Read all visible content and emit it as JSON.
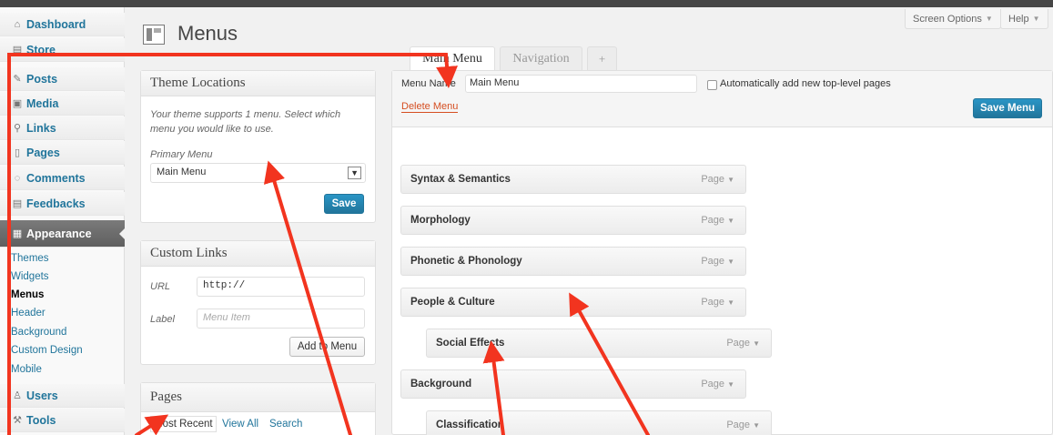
{
  "header": {
    "title": "Menus",
    "screen_options": "Screen Options",
    "help": "Help"
  },
  "sidebar": {
    "items": [
      {
        "label": "Dashboard",
        "icon": "dashboard-icon",
        "glyph": "⌂"
      },
      {
        "label": "Store",
        "icon": "store-icon",
        "glyph": "▤"
      },
      {
        "label": "Posts",
        "icon": "posts-icon",
        "glyph": "✎"
      },
      {
        "label": "Media",
        "icon": "media-icon",
        "glyph": "▣"
      },
      {
        "label": "Links",
        "icon": "links-icon",
        "glyph": "⚲"
      },
      {
        "label": "Pages",
        "icon": "pages-icon",
        "glyph": "▯"
      },
      {
        "label": "Comments",
        "icon": "comments-icon",
        "glyph": "◌"
      },
      {
        "label": "Feedbacks",
        "icon": "feedbacks-icon",
        "glyph": "▤"
      },
      {
        "label": "Appearance",
        "icon": "appearance-icon",
        "glyph": "▦"
      },
      {
        "label": "Users",
        "icon": "users-icon",
        "glyph": "♙"
      },
      {
        "label": "Tools",
        "icon": "tools-icon",
        "glyph": "⚒"
      }
    ],
    "appearance_sub": [
      "Themes",
      "Widgets",
      "Menus",
      "Header",
      "Background",
      "Custom Design",
      "Mobile"
    ]
  },
  "theme_locations": {
    "title": "Theme Locations",
    "description": "Your theme supports 1 menu. Select which menu you would like to use.",
    "primary_label": "Primary Menu",
    "selected": "Main Menu",
    "save": "Save"
  },
  "custom_links": {
    "title": "Custom Links",
    "url_label": "URL",
    "url_value": "http://",
    "label_label": "Label",
    "label_placeholder": "Menu Item",
    "add_button": "Add to Menu"
  },
  "pages_box": {
    "title": "Pages",
    "tabs": [
      "Most Recent",
      "View All",
      "Search"
    ]
  },
  "tabs": [
    "Main Menu",
    "Navigation",
    "+"
  ],
  "editor": {
    "menu_name_label": "Menu Name",
    "menu_name_value": "Main Menu",
    "auto_add": "Automatically add new top-level pages",
    "delete": "Delete Menu",
    "save": "Save Menu",
    "items": [
      {
        "label": "Syntax & Semantics",
        "type": "Page",
        "depth": 0
      },
      {
        "label": "Morphology",
        "type": "Page",
        "depth": 0
      },
      {
        "label": "Phonetic & Phonology",
        "type": "Page",
        "depth": 0
      },
      {
        "label": "People & Culture",
        "type": "Page",
        "depth": 0
      },
      {
        "label": "Social Effects",
        "type": "Page",
        "depth": 1
      },
      {
        "label": "Background",
        "type": "Page",
        "depth": 0
      },
      {
        "label": "Classification",
        "type": "Page",
        "depth": 1
      }
    ]
  },
  "colors": {
    "accent": "#21759b",
    "annotation": "#f2341f",
    "delete": "#d54e21"
  }
}
